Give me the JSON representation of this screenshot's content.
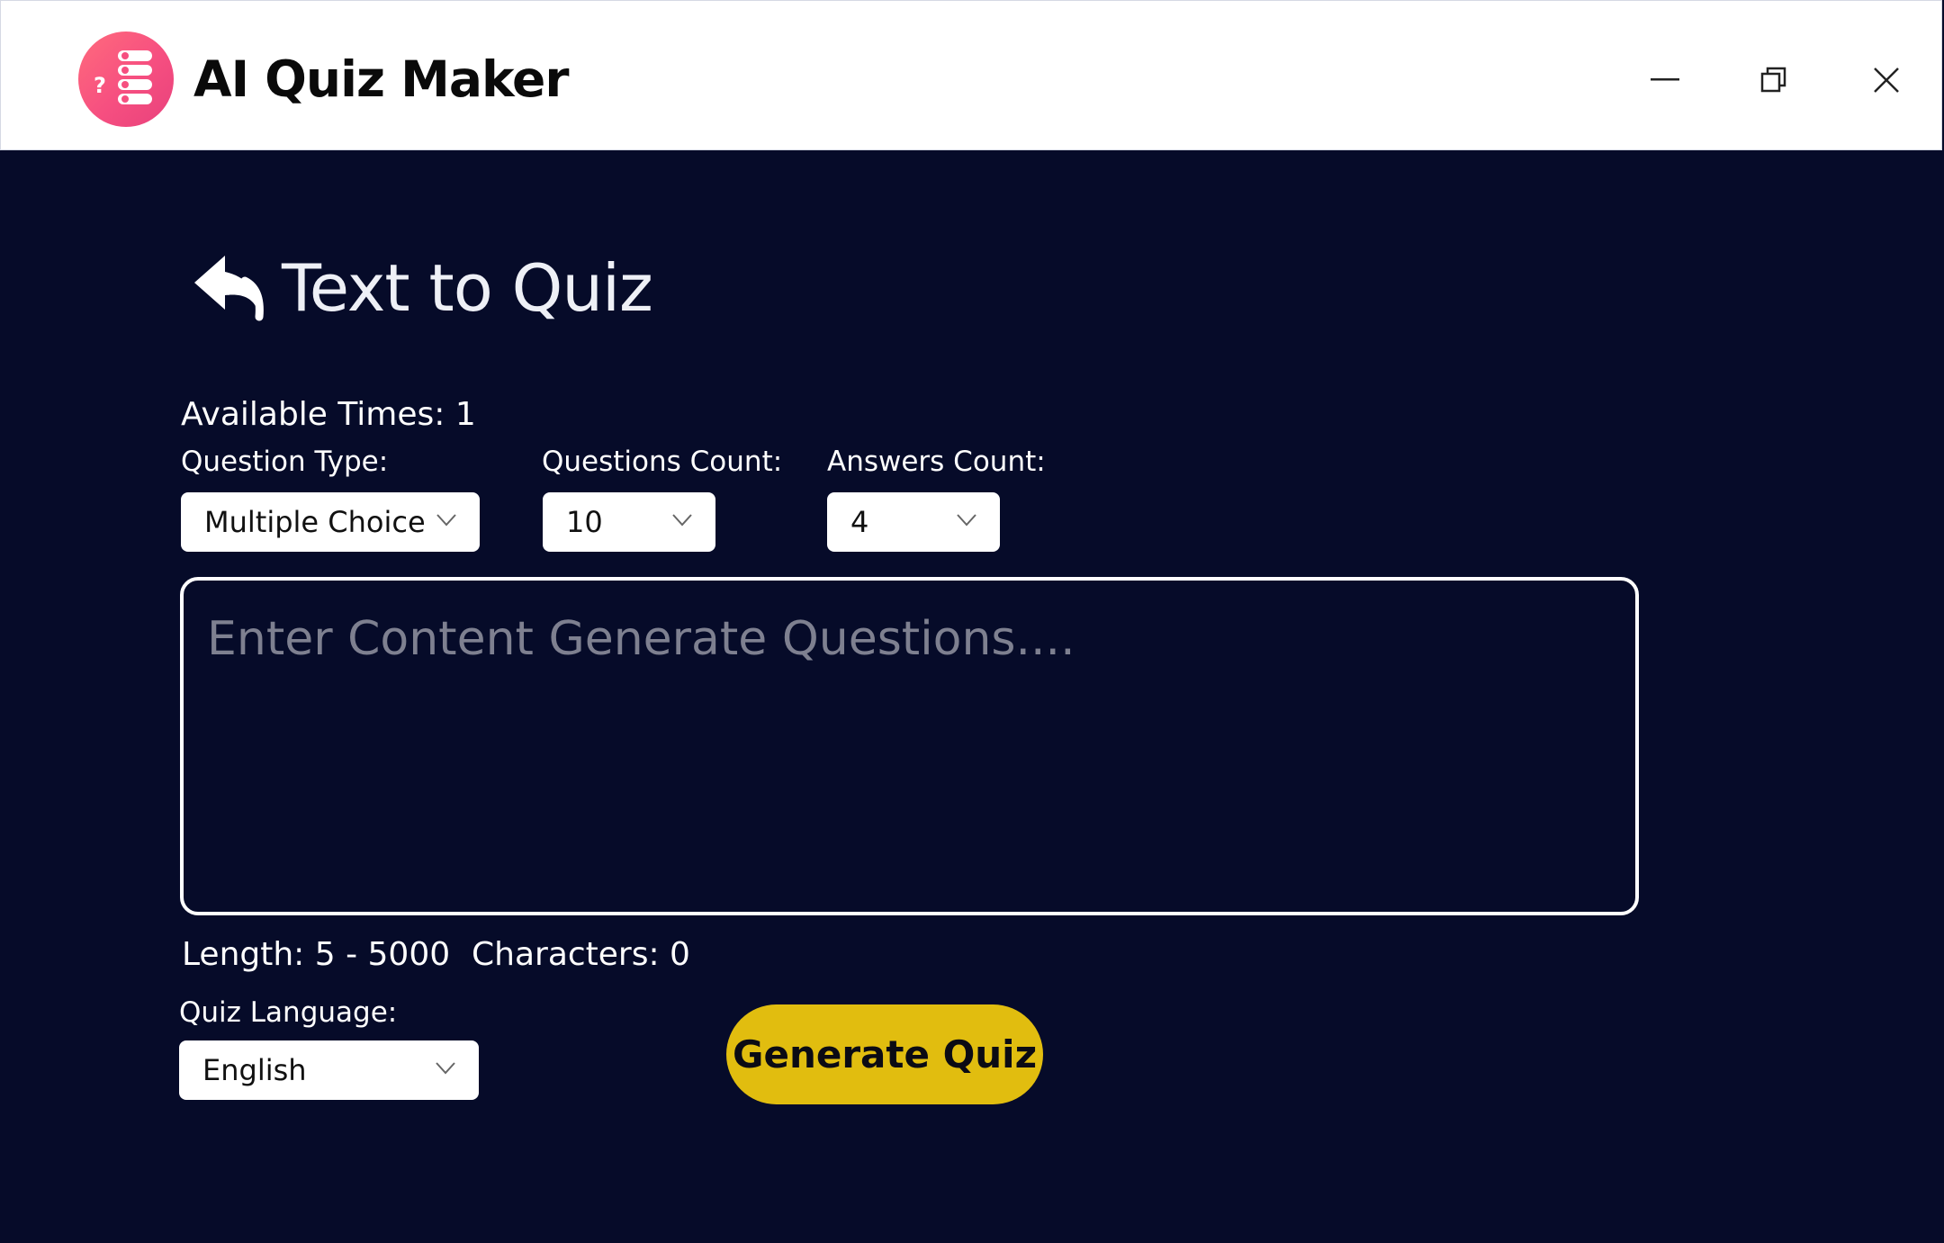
{
  "window": {
    "title": "AI Quiz Maker",
    "logo_icon": "quiz-list-icon",
    "controls": [
      "minimize-icon",
      "restore-icon",
      "close-icon"
    ]
  },
  "page": {
    "back_icon": "back-arrow-icon",
    "title": "Text to Quiz"
  },
  "settings": {
    "available_times": "Available Times: 1",
    "question_type": {
      "label": "Question Type:",
      "value": "Multiple Choice"
    },
    "questions_count": {
      "label": "Questions Count:",
      "value": "10"
    },
    "answers_count": {
      "label": "Answers Count:",
      "value": "4"
    }
  },
  "content": {
    "placeholder": "Enter Content Generate Questions....",
    "value": "",
    "length_text": "Length: 5 - 5000",
    "characters_text": "Characters: 0"
  },
  "language": {
    "label": "Quiz Language:",
    "value": "English"
  },
  "actions": {
    "generate_label": "Generate Quiz"
  },
  "colors": {
    "background": "#060b29",
    "titlebar": "#ffffff",
    "logo": "#f64f80",
    "generate_button": "#e1bd0f",
    "placeholder": "#7e8090"
  }
}
